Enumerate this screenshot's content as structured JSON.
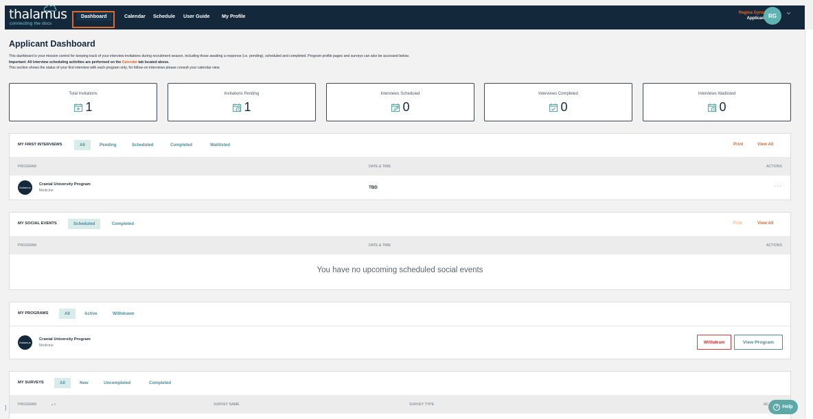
{
  "brand": {
    "name": "thalamus",
    "tagline": "connecting the docs"
  },
  "nav": {
    "items": [
      {
        "label": "Dashboard"
      },
      {
        "label": "Calendar"
      },
      {
        "label": "Schedule"
      },
      {
        "label": "User Guide"
      },
      {
        "label": "My Profile"
      }
    ],
    "user_name": "Regina Gyrus",
    "user_role": "Applicant",
    "user_initials": "RG"
  },
  "page": {
    "title": "Applicant Dashboard",
    "intro_1": "This dashboard is your mission control for keeping track of your interview invitations during recruitment season, including those awaiting a response (i.e. pending), scheduled and completed. Program profile pages and surveys can also be accessed below.",
    "intro_2a": "Important: All interview scheduling activities are performed on the ",
    "intro_2_link": "Calendar",
    "intro_2b": " tab located above.",
    "intro_3": "This section shows the status of your first interview with each program only, for follow-on interviews please consult your calendar view."
  },
  "stats": [
    {
      "label": "Total Invitations",
      "value": "1",
      "icon": "calendar-plus-icon"
    },
    {
      "label": "Invitations Pending",
      "value": "1",
      "icon": "calendar-clock-icon"
    },
    {
      "label": "Interviews Scheduled",
      "value": "0",
      "icon": "calendar-edit-icon"
    },
    {
      "label": "Interviews Completed",
      "value": "0",
      "icon": "calendar-check-icon"
    },
    {
      "label": "Interviews Waitlisted",
      "value": "0",
      "icon": "calendar-clock-icon"
    }
  ],
  "first_interviews": {
    "title": "MY FIRST INTERVIEWS",
    "tabs": [
      "All",
      "Pending",
      "Scheduled",
      "Completed",
      "Waitlisted"
    ],
    "print": "Print",
    "view_all": "View All",
    "columns": [
      "PROGRAM",
      "DATE & TIME",
      "ACTIONS"
    ],
    "rows": [
      {
        "logo": "thalamus",
        "program": "Cranial University Program",
        "specialty": "Medicine",
        "datetime": "TBD",
        "actions": "···"
      }
    ]
  },
  "social_events": {
    "title": "MY SOCIAL EVENTS",
    "tabs": [
      "Scheduled",
      "Completed"
    ],
    "print": "Print",
    "view_all": "View All",
    "columns": [
      "PROGRAM",
      "DATE & TIME",
      "ACTIONS"
    ],
    "empty": "You have no upcoming scheduled social events"
  },
  "programs": {
    "title": "MY PROGRAMS",
    "tabs": [
      "All",
      "Active",
      "Withdrawn"
    ],
    "rows": [
      {
        "logo": "thalamus",
        "program": "Cranial University Program",
        "specialty": "Medicine"
      }
    ],
    "withdraw": "Withdraw",
    "view_program": "View Program"
  },
  "surveys": {
    "title": "MY SURVEYS",
    "tabs": [
      "All",
      "New",
      "Uncompleted",
      "Completed"
    ],
    "columns": [
      "PROGRAM",
      "SURVEY NAME",
      "SURVEY TYPE",
      "AC"
    ]
  },
  "help": {
    "label": "Help"
  },
  "colors": {
    "nav_bg": "#14283b",
    "accent": "#e0692b",
    "teal": "#5fa8a8",
    "danger": "#cf3a3a"
  }
}
